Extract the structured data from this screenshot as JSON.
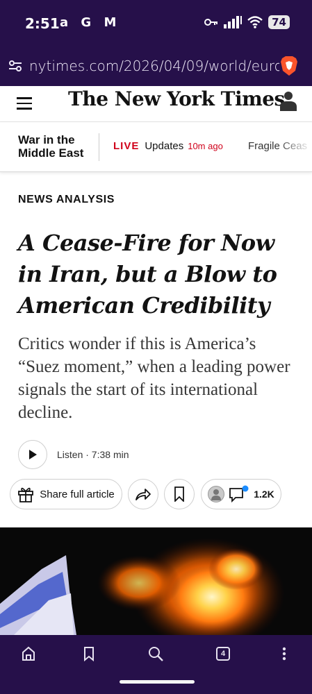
{
  "status_bar": {
    "time": "2:51",
    "app_icons": "a G M",
    "battery": "74"
  },
  "browser": {
    "url": "nytimes.com/2026/04/09/world/europ"
  },
  "header": {
    "logo": "The New York Times"
  },
  "section_bar": {
    "title": "War in the Middle East",
    "live_label": "LIVE",
    "live_updates": "Updates",
    "live_time": "10m ago",
    "next_item": "Fragile Ceas"
  },
  "article": {
    "kicker": "NEWS ANALYSIS",
    "headline": "A Cease-Fire for Now in Iran, but a Blow to American Credibility",
    "dek": "Critics wonder if this is America’s “Suez moment,” when a leading power signals the start of its international decline.",
    "listen_label": "Listen · 7:38 min",
    "share_full_label": "Share full article",
    "comment_count": "1.2K"
  },
  "bottom_nav": {
    "tab_count": "4"
  },
  "colors": {
    "browser_chrome": "#26104a",
    "live_red": "#d0021b",
    "notification_blue": "#1a8cff"
  }
}
